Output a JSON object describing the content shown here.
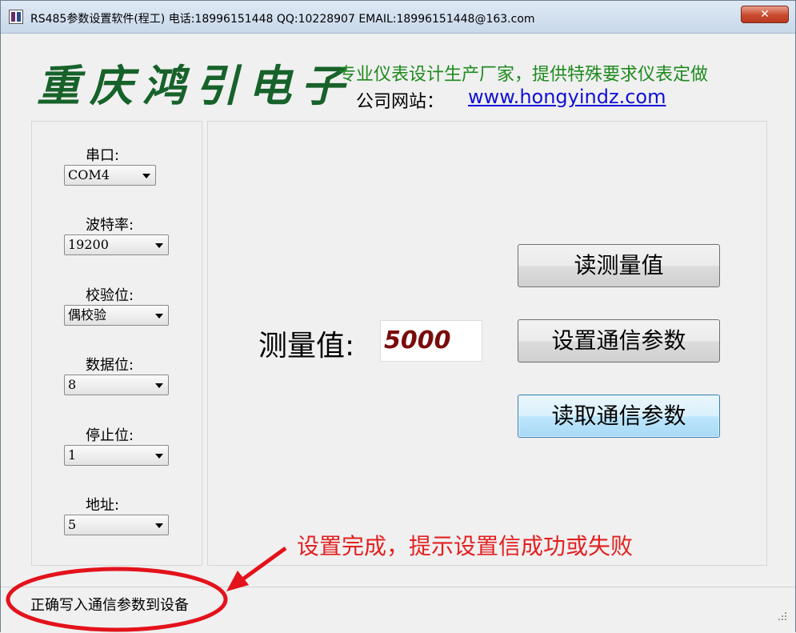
{
  "window": {
    "title": "RS485参数设置软件(程工)  电话:18996151448  QQ:10228907  EMAIL:18996151448@163.com",
    "close_label": "✕"
  },
  "header": {
    "brand": "重庆鸿引电子",
    "slogan": "专业仪表设计生产厂家，提供特殊要求仪表定做",
    "site_label": "公司网站：",
    "site_url": "www.hongyindz.com"
  },
  "settings": {
    "port_label": "串口:",
    "port_value": "COM4",
    "baud_label": "波特率:",
    "baud_value": "19200",
    "parity_label": "校验位:",
    "parity_value": "偶校验",
    "databits_label": "数据位:",
    "databits_value": "8",
    "stopbits_label": "停止位:",
    "stopbits_value": "1",
    "address_label": "地址:",
    "address_value": "5"
  },
  "main": {
    "measure_label": "测量值:",
    "measure_value": "5000",
    "read_measure_button": "读测量值",
    "set_params_button": "设置通信参数",
    "read_params_button": "读取通信参数"
  },
  "annotation": {
    "text": "设置完成，提示设置信成功或失败",
    "color": "#e32020"
  },
  "status": {
    "text": "正确写入通信参数到设备"
  }
}
